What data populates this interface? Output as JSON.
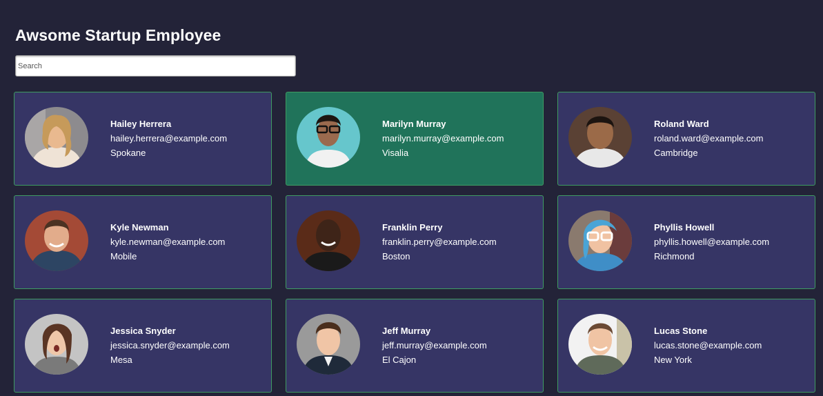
{
  "header": {
    "title": "Awsome Startup Employee"
  },
  "search": {
    "placeholder": "Search",
    "value": ""
  },
  "colors": {
    "background": "#232338",
    "card": "#363565",
    "card_highlight": "#20735a",
    "card_border": "#3f9c62"
  },
  "employees": [
    {
      "name": "Hailey Herrera",
      "email": "hailey.herrera@example.com",
      "city": "Spokane",
      "avatar": "photo-avatar",
      "highlighted": false
    },
    {
      "name": "Marilyn Murray",
      "email": "marilyn.murray@example.com",
      "city": "Visalia",
      "avatar": "photo-avatar",
      "highlighted": true
    },
    {
      "name": "Roland Ward",
      "email": "roland.ward@example.com",
      "city": "Cambridge",
      "avatar": "photo-avatar",
      "highlighted": false
    },
    {
      "name": "Kyle Newman",
      "email": "kyle.newman@example.com",
      "city": "Mobile",
      "avatar": "photo-avatar",
      "highlighted": false
    },
    {
      "name": "Franklin Perry",
      "email": "franklin.perry@example.com",
      "city": "Boston",
      "avatar": "photo-avatar",
      "highlighted": false
    },
    {
      "name": "Phyllis Howell",
      "email": "phyllis.howell@example.com",
      "city": "Richmond",
      "avatar": "photo-avatar",
      "highlighted": false
    },
    {
      "name": "Jessica Snyder",
      "email": "jessica.snyder@example.com",
      "city": "Mesa",
      "avatar": "photo-avatar",
      "highlighted": false
    },
    {
      "name": "Jeff Murray",
      "email": "jeff.murray@example.com",
      "city": "El Cajon",
      "avatar": "photo-avatar",
      "highlighted": false
    },
    {
      "name": "Lucas Stone",
      "email": "lucas.stone@example.com",
      "city": "New York",
      "avatar": "photo-avatar",
      "highlighted": false
    }
  ]
}
